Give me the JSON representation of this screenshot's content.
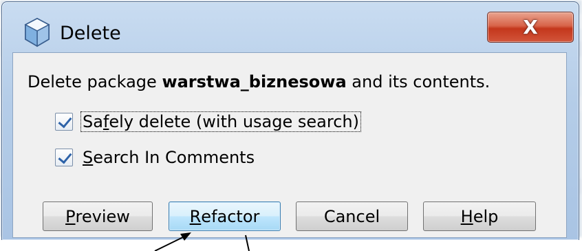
{
  "window": {
    "title": "Delete",
    "close_glyph": "X"
  },
  "dialog": {
    "message_prefix": "Delete package ",
    "package_name": "warstwa_biznesowa",
    "message_suffix": " and its contents."
  },
  "options": [
    {
      "label_pre": "Sa",
      "label_mnemonic": "f",
      "label_post": "ely delete (with usage search)",
      "checked": true
    },
    {
      "label_pre": "",
      "label_mnemonic": "S",
      "label_post": "earch In Comments",
      "checked": true
    }
  ],
  "buttons": {
    "preview": {
      "mnemonic": "P",
      "rest": "review"
    },
    "refactor": {
      "mnemonic": "R",
      "rest": "efactor"
    },
    "cancel": {
      "label": "Cancel"
    },
    "help": {
      "mnemonic": "H",
      "rest": "elp"
    }
  },
  "colors": {
    "close_button": "#c4371c",
    "default_button_border": "#3c7fb1",
    "checkmark": "#2d62a8"
  },
  "icons": {
    "app": "cube-icon",
    "close": "close-icon",
    "checkbox": "checkmark-icon"
  }
}
